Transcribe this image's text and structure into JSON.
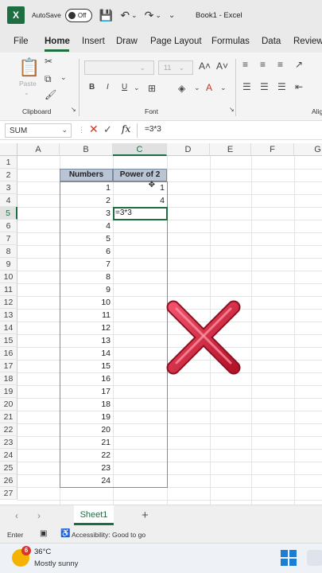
{
  "titlebar": {
    "app_letter": "X",
    "autosave_label": "AutoSave",
    "toggle_label": "Off",
    "doc_title": "Book1  -  Excel"
  },
  "ribbon_tabs": [
    "File",
    "Home",
    "Insert",
    "Draw",
    "Page Layout",
    "Formulas",
    "Data",
    "Review"
  ],
  "ribbon": {
    "clipboard_label": "Clipboard",
    "font_label": "Font",
    "align_label": "Alig",
    "paste_label": "Paste",
    "font_size": "11"
  },
  "formula_bar": {
    "name_box": "SUM",
    "fx": "fx",
    "formula": "=3*3"
  },
  "grid": {
    "columns": [
      "A",
      "B",
      "C",
      "D",
      "E",
      "F",
      "G"
    ],
    "rows": [
      "1",
      "2",
      "3",
      "4",
      "5",
      "6",
      "7",
      "8",
      "9",
      "10",
      "11",
      "12",
      "13",
      "14",
      "15",
      "16",
      "17",
      "18",
      "19",
      "20",
      "21",
      "22",
      "23",
      "24",
      "25",
      "26",
      "27"
    ],
    "header_numbers": "Numbers",
    "header_power": "Power of 2",
    "numbers": [
      "1",
      "2",
      "3",
      "4",
      "5",
      "6",
      "7",
      "8",
      "9",
      "10",
      "11",
      "12",
      "13",
      "14",
      "15",
      "16",
      "17",
      "18",
      "19",
      "20",
      "21",
      "22",
      "23",
      "24"
    ],
    "power_values": [
      "1",
      "4"
    ],
    "active_cell_content": "=3*3"
  },
  "sheet_tabs": {
    "active": "Sheet1"
  },
  "status": {
    "mode": "Enter",
    "accessibility": "Accessibility: Good to go"
  },
  "taskbar": {
    "badge": "6",
    "temperature": "36°C",
    "condition": "Mostly sunny"
  },
  "colors": {
    "excel_green": "#1d6f42",
    "header_fill": "#b9c4d4",
    "x_red": "#d7263d"
  }
}
